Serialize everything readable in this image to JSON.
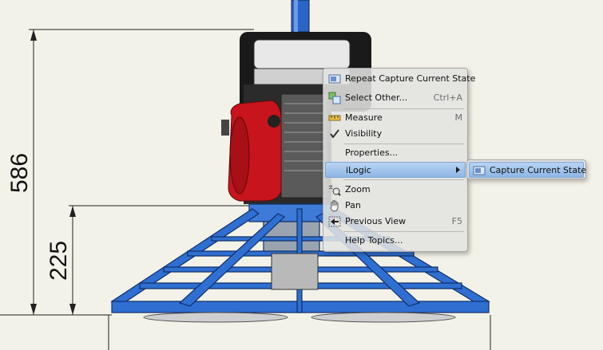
{
  "dimensions": {
    "overall_height": "586",
    "frame_height": "225"
  },
  "context_menu": {
    "items": [
      {
        "label": "Repeat Capture Current State",
        "shortcut": "",
        "icon": "capture-state-icon"
      },
      {
        "label": "Select Other...",
        "shortcut": "Ctrl+A",
        "icon": "select-other-icon"
      },
      {
        "label": "Measure",
        "shortcut": "M",
        "icon": "measure-icon"
      },
      {
        "label": "Visibility",
        "shortcut": "",
        "icon": "checkmark-icon"
      },
      {
        "label": "Properties...",
        "shortcut": "",
        "icon": ""
      },
      {
        "label": "iLogic",
        "shortcut": "",
        "icon": ""
      },
      {
        "label": "Zoom",
        "shortcut": "",
        "icon": "zoom-icon"
      },
      {
        "label": "Pan",
        "shortcut": "",
        "icon": "pan-hand-icon"
      },
      {
        "label": "Previous View",
        "shortcut": "F5",
        "icon": "previous-view-icon"
      },
      {
        "label": "Help Topics...",
        "shortcut": "",
        "icon": ""
      }
    ]
  },
  "submenu": {
    "items": [
      {
        "label": "Capture Current State",
        "icon": "capture-state-icon"
      }
    ]
  },
  "colors": {
    "frame_blue": "#2f6fd1",
    "engine_red": "#c8141c",
    "highlight": "#9dc0ea"
  }
}
